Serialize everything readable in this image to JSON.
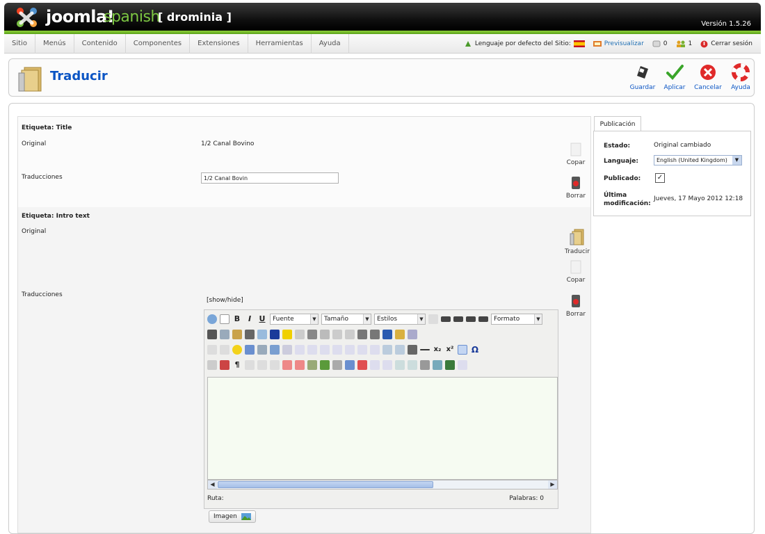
{
  "header": {
    "brand": "joomla!",
    "brand_sub": "spanish",
    "site_name": "[ drominia ]",
    "version": "Versión 1.5.26"
  },
  "menu": {
    "items": [
      "Sitio",
      "Menús",
      "Contenido",
      "Componentes",
      "Extensiones",
      "Herramientas",
      "Ayuda"
    ]
  },
  "status": {
    "language_label": "Lenguaje por defecto del Sitio:",
    "preview": "Previsualizar",
    "messages_count": "0",
    "users_count": "1",
    "logout": "Cerrar sesión"
  },
  "toolbar": {
    "title": "Traducir",
    "save": "Guardar",
    "apply": "Aplicar",
    "cancel": "Cancelar",
    "help": "Ayuda"
  },
  "form": {
    "title_section": "Etiqueta: Title",
    "original_label": "Original",
    "original_title": "1/2 Canal Bovino",
    "translations_label": "Traducciones",
    "translation_title": "1/2 Canal Bovin",
    "intro_section": "Etiqueta: Intro text",
    "intro_original_label": "Original",
    "intro_translations_label": "Traducciones",
    "show_hide": "[show/hide]",
    "copy": "Copar",
    "delete": "Borrar",
    "translate": "Traducir",
    "copy2": "Copar",
    "delete2": "Borrar"
  },
  "editor": {
    "font": "Fuente",
    "size": "Tamaño",
    "styles": "Estilos",
    "format": "Formato",
    "path_label": "Ruta:",
    "words": "Palabras: 0",
    "image_button": "Imagen"
  },
  "publication": {
    "tab": "Publicación",
    "state_label": "Estado:",
    "state_value": "Original cambiado",
    "language_label": "Languaje:",
    "language_value": "English (United Kingdom)",
    "published_label": "Publicado:",
    "published_checked": true,
    "modified_label_1": "Última",
    "modified_label_2": "modificación:",
    "modified_value": "Jueves, 17 Mayo 2012 12:18"
  },
  "colors": {
    "accent_blue": "#0b55c4",
    "header_black": "#101010",
    "green_bar": "#6ab82a"
  }
}
